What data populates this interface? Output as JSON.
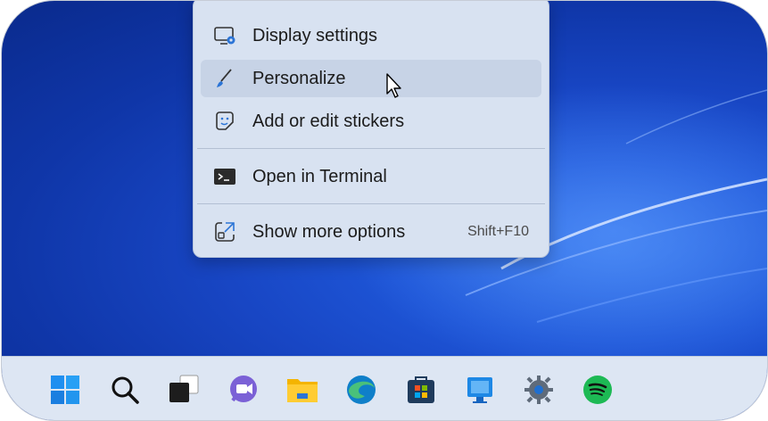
{
  "context_menu": {
    "items": [
      {
        "label": "Display settings",
        "icon": "display-settings-icon"
      },
      {
        "label": "Personalize",
        "icon": "brush-icon",
        "hovered": true
      },
      {
        "label": "Add or edit stickers",
        "icon": "sticker-icon"
      },
      {
        "label": "Open in Terminal",
        "icon": "terminal-icon"
      },
      {
        "label": "Show more options",
        "icon": "external-options-icon",
        "shortcut": "Shift+F10"
      }
    ]
  },
  "taskbar": {
    "icons": [
      "windows-start-icon",
      "search-icon",
      "task-view-icon",
      "teams-chat-icon",
      "file-explorer-icon",
      "edge-icon",
      "microsoft-store-icon",
      "remote-desktop-icon",
      "settings-gear-icon",
      "spotify-icon"
    ]
  },
  "colors": {
    "wallpaper": "#1846c4",
    "menu_bg": "#d8e2f1",
    "menu_hover": "#c7d3e6",
    "taskbar_bg": "#dde6f3"
  }
}
